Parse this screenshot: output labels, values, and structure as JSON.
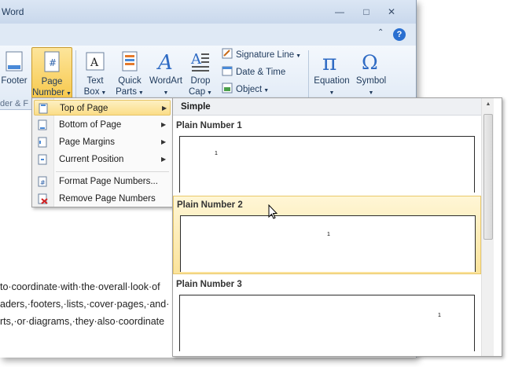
{
  "window": {
    "title": "Word"
  },
  "ribbon": {
    "footer_label": "Footer",
    "page_number_label": "Page\nNumber",
    "text_box_label": "Text\nBox",
    "quick_parts_label": "Quick\nParts",
    "wordart_label": "WordArt",
    "drop_cap_label": "Drop\nCap",
    "signature_line_label": "Signature Line",
    "date_time_label": "Date & Time",
    "object_label": "Object",
    "equation_label": "Equation",
    "symbol_label": "Symbol",
    "group_label": "der & F"
  },
  "menu": {
    "items": [
      {
        "label": "Top of Page"
      },
      {
        "label": "Bottom of Page"
      },
      {
        "label": "Page Margins"
      },
      {
        "label": "Current Position"
      },
      {
        "label": "Format Page Numbers..."
      },
      {
        "label": "Remove Page Numbers"
      }
    ]
  },
  "gallery": {
    "section": "Simple",
    "items": [
      {
        "label": "Plain Number 1",
        "num": "1"
      },
      {
        "label": "Plain Number 2",
        "num": "1"
      },
      {
        "label": "Plain Number 3",
        "num": "1"
      }
    ]
  },
  "document": {
    "lines": [
      "to·coordinate·with·the·overall·look·of",
      "aders,·footers,·lists,·cover·pages,·and·",
      "rts,·or·diagrams,·they·also·coordinate"
    ]
  },
  "colors": {
    "accent": "#fbdd87",
    "ribbon": "#dfe9f5"
  }
}
